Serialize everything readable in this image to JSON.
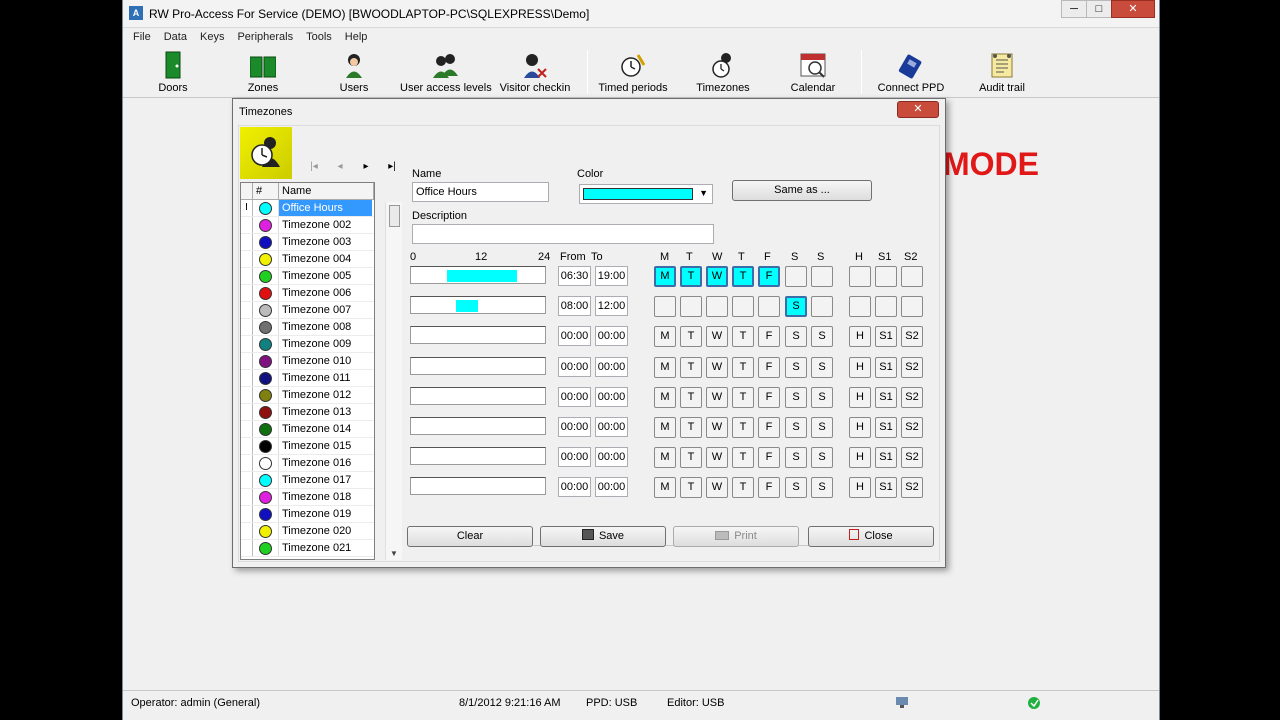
{
  "window": {
    "title": "RW Pro-Access For Service (DEMO) [BWOODLAPTOP-PC\\SQLEXPRESS\\Demo]",
    "min": "─",
    "max": "□",
    "close": "✕"
  },
  "menu": [
    "File",
    "Data",
    "Keys",
    "Peripherals",
    "Tools",
    "Help"
  ],
  "toolbar": [
    "Doors",
    "Zones",
    "Users",
    "User access levels",
    "Visitor checkin",
    "Timed periods",
    "Timezones",
    "Calendar",
    "Connect PPD",
    "Audit trail"
  ],
  "background_text": "MODE",
  "status": {
    "operator": "Operator: admin (General)",
    "datetime": "8/1/2012 9:21:16 AM",
    "ppd": "PPD: USB",
    "editor": "Editor: USB"
  },
  "dialog": {
    "title": "Timezones",
    "close": "✕",
    "nav": [
      "|◂",
      "◂",
      "▸",
      "▸|"
    ],
    "list_headers": [
      "#",
      "Name"
    ],
    "list": [
      {
        "name": "Office Hours",
        "color": "#00ffff",
        "selected": true
      },
      {
        "name": "Timezone 002",
        "color": "#e020e0"
      },
      {
        "name": "Timezone 003",
        "color": "#1010c0"
      },
      {
        "name": "Timezone 004",
        "color": "#f0f000"
      },
      {
        "name": "Timezone 005",
        "color": "#20d020"
      },
      {
        "name": "Timezone 006",
        "color": "#e01010"
      },
      {
        "name": "Timezone 007",
        "color": "#bbbbbb"
      },
      {
        "name": "Timezone 008",
        "color": "#707070"
      },
      {
        "name": "Timezone 009",
        "color": "#108080"
      },
      {
        "name": "Timezone 010",
        "color": "#801080"
      },
      {
        "name": "Timezone 011",
        "color": "#101080"
      },
      {
        "name": "Timezone 012",
        "color": "#808010"
      },
      {
        "name": "Timezone 013",
        "color": "#901010"
      },
      {
        "name": "Timezone 014",
        "color": "#107010"
      },
      {
        "name": "Timezone 015",
        "color": "#000000"
      },
      {
        "name": "Timezone 016",
        "color": "#ffffff"
      },
      {
        "name": "Timezone 017",
        "color": "#00ffff"
      },
      {
        "name": "Timezone 018",
        "color": "#e020e0"
      },
      {
        "name": "Timezone 019",
        "color": "#1010c0"
      },
      {
        "name": "Timezone 020",
        "color": "#f0f000"
      },
      {
        "name": "Timezone 021",
        "color": "#20d020"
      }
    ],
    "name_label": "Name",
    "name_value": "Office Hours",
    "color_label": "Color",
    "color_value": "#00ffff",
    "same_as": "Same as ...",
    "description_label": "Description",
    "description_value": "",
    "scale": [
      "0",
      "12",
      "24"
    ],
    "from_label": "From",
    "to_label": "To",
    "day_headers": [
      "M",
      "T",
      "W",
      "T",
      "F",
      "S",
      "S",
      "H",
      "S1",
      "S2"
    ],
    "rows": [
      {
        "from": "06:30",
        "to": "19:00",
        "days": [
          "M",
          "T",
          "W",
          "T",
          "F",
          "",
          "",
          "",
          "",
          ""
        ],
        "on": [
          1,
          1,
          1,
          1,
          1,
          0,
          0,
          0,
          0,
          0
        ]
      },
      {
        "from": "08:00",
        "to": "12:00",
        "days": [
          "",
          "",
          "",
          "",
          "",
          "S",
          "",
          "",
          "",
          ""
        ],
        "on": [
          0,
          0,
          0,
          0,
          0,
          1,
          0,
          0,
          0,
          0
        ]
      },
      {
        "from": "00:00",
        "to": "00:00",
        "days": [
          "M",
          "T",
          "W",
          "T",
          "F",
          "S",
          "S",
          "H",
          "S1",
          "S2"
        ],
        "on": [
          0,
          0,
          0,
          0,
          0,
          0,
          0,
          0,
          0,
          0
        ]
      },
      {
        "from": "00:00",
        "to": "00:00",
        "days": [
          "M",
          "T",
          "W",
          "T",
          "F",
          "S",
          "S",
          "H",
          "S1",
          "S2"
        ],
        "on": [
          0,
          0,
          0,
          0,
          0,
          0,
          0,
          0,
          0,
          0
        ]
      },
      {
        "from": "00:00",
        "to": "00:00",
        "days": [
          "M",
          "T",
          "W",
          "T",
          "F",
          "S",
          "S",
          "H",
          "S1",
          "S2"
        ],
        "on": [
          0,
          0,
          0,
          0,
          0,
          0,
          0,
          0,
          0,
          0
        ]
      },
      {
        "from": "00:00",
        "to": "00:00",
        "days": [
          "M",
          "T",
          "W",
          "T",
          "F",
          "S",
          "S",
          "H",
          "S1",
          "S2"
        ],
        "on": [
          0,
          0,
          0,
          0,
          0,
          0,
          0,
          0,
          0,
          0
        ]
      },
      {
        "from": "00:00",
        "to": "00:00",
        "days": [
          "M",
          "T",
          "W",
          "T",
          "F",
          "S",
          "S",
          "H",
          "S1",
          "S2"
        ],
        "on": [
          0,
          0,
          0,
          0,
          0,
          0,
          0,
          0,
          0,
          0
        ]
      },
      {
        "from": "00:00",
        "to": "00:00",
        "days": [
          "M",
          "T",
          "W",
          "T",
          "F",
          "S",
          "S",
          "H",
          "S1",
          "S2"
        ],
        "on": [
          0,
          0,
          0,
          0,
          0,
          0,
          0,
          0,
          0,
          0
        ]
      }
    ],
    "buttons": {
      "clear": "Clear",
      "save": "Save",
      "print": "Print",
      "close": "Close"
    }
  }
}
